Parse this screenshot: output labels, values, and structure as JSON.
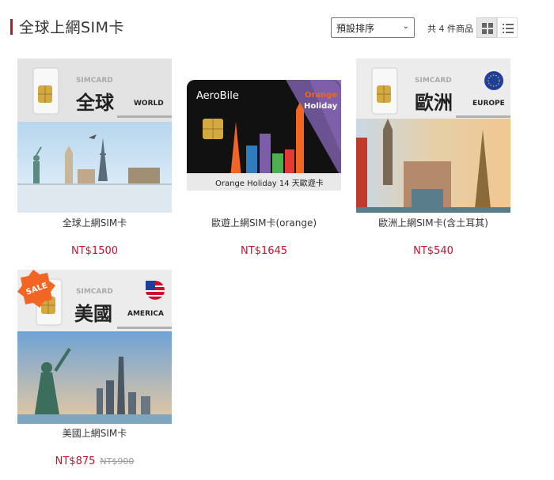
{
  "header": {
    "title": "全球上網SIM卡",
    "sort": {
      "selected": "預設排序"
    },
    "count_label": "共 4 件商品",
    "view_modes": [
      "grid",
      "list"
    ],
    "active_view": "grid"
  },
  "products": [
    {
      "name": "全球上網SIM卡",
      "price": "NT$1500",
      "image": {
        "simcard": "SIMCARD",
        "big": "全球",
        "region": "WORLD"
      }
    },
    {
      "name": "歐遊上網SIM卡(orange)",
      "price": "NT$1645",
      "image": {
        "brand": "AeroBile",
        "tag1": "Orange",
        "tag2": "Holiday",
        "caption": "Orange Holiday 14 天歐遊卡"
      }
    },
    {
      "name": "歐洲上網SIM卡(含土耳其)",
      "price": "NT$540",
      "image": {
        "simcard": "SIMCARD",
        "big": "歐洲",
        "region": "EUROPE"
      }
    },
    {
      "name": "美國上網SIM卡",
      "price": "NT$875",
      "old_price": "NT$900",
      "image": {
        "simcard": "SIMCARD",
        "big": "美國",
        "region": "AMERICA",
        "badge": "SALE"
      }
    }
  ],
  "colors": {
    "accent": "#c8102e",
    "orange": "#f26522",
    "purple": "#7b5ea7"
  }
}
